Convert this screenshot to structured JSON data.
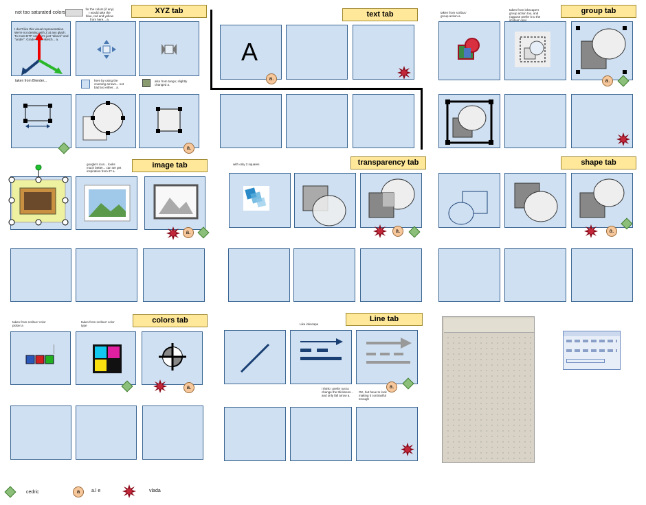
{
  "tabs": {
    "xyz": "XYZ tab",
    "text": "text tab",
    "group": "group tab",
    "image": "image tab",
    "transparency": "transparency tab",
    "shape": "shape tab",
    "colors": "colors tab",
    "line": "Line tab"
  },
  "notes": {
    "not_saturated": "not too saturated colors",
    "for_colors": "for the colors (if any) I would take the blue, red and yellow from here... a.",
    "xyz_desc": "I don't like this visual representation. We're not dealing with Z at any glyph. To most DTP users it's just \"above\" and \"under\". Grade is 3D sketch... a.",
    "taken_blender": "taken from Blender...",
    "zoom_arrows": "here by using the zooming arrows... not bad too either... a.",
    "tango": "also from tango; slightly changed a.",
    "text_letter": "A",
    "scribus_group": "taken from scribus' group action a.",
    "inkscape_group": "taken from inkscape's group action too, and (ogpose prefer it to the scribus' one)",
    "google_icon": "google's icon... looks much better... can we get inspiration from it? a.",
    "only_two_squares": "with only 2 squares",
    "scribus_color_picker": "taken from scribus' color picker a",
    "scribus_color_type": "taken from scribus' color type",
    "like_inkscape": "Like inkscape",
    "prefer_not": "i think I prefer not to change the thickness... and only fall arrow a.",
    "ok_but": "OK, but have to look making it contrastful enough"
  },
  "legend": {
    "cedric": "cedric",
    "a_e": "a.l e",
    "vlada": "vlada",
    "a_letter": "a"
  },
  "badge_letter": "a.",
  "colors": {
    "box_fill": "#cfe0f2",
    "box_border": "#3a6592",
    "tab_fill": "#ffe89a",
    "badge_a": "#f6c79a",
    "badge_diamond": "#8cc07a",
    "badge_star": "#8b0a1a"
  }
}
